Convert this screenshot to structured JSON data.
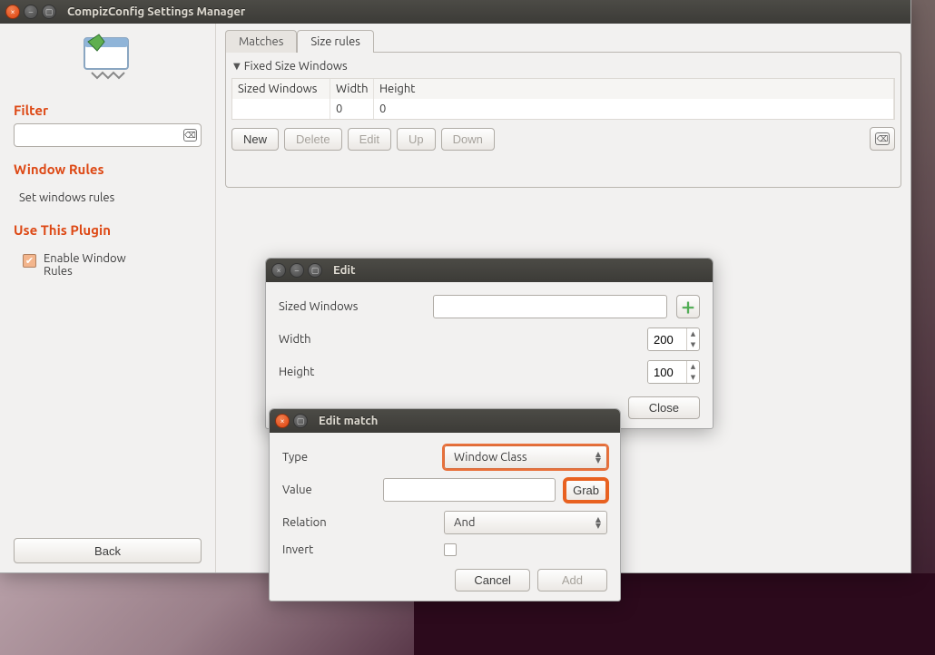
{
  "main": {
    "title": "CompizConfig Settings Manager",
    "sidebar": {
      "filter_heading": "Filter",
      "filter_value": "",
      "section_heading": "Window Rules",
      "item_set_rules": "Set windows rules",
      "use_plugin_heading": "Use This Plugin",
      "enable_label": "Enable Window Rules",
      "back": "Back"
    },
    "tabs": {
      "matches": "Matches",
      "size_rules": "Size rules"
    },
    "panel": {
      "fixed_size_heading": "Fixed Size Windows",
      "cols": {
        "sized": "Sized Windows",
        "width": "Width",
        "height": "Height"
      },
      "row": {
        "sized": "",
        "width": "0",
        "height": "0"
      },
      "buttons": {
        "new": "New",
        "delete": "Delete",
        "edit": "Edit",
        "up": "Up",
        "down": "Down"
      }
    }
  },
  "edit_dlg": {
    "title": "Edit",
    "sized_label": "Sized Windows",
    "sized_value": "",
    "width_label": "Width",
    "width_value": "200",
    "height_label": "Height",
    "height_value": "100",
    "close": "Close"
  },
  "match_dlg": {
    "title": "Edit match",
    "type_label": "Type",
    "type_value": "Window Class",
    "value_label": "Value",
    "value_value": "",
    "grab": "Grab",
    "relation_label": "Relation",
    "relation_value": "And",
    "invert_label": "Invert",
    "cancel": "Cancel",
    "add": "Add"
  }
}
